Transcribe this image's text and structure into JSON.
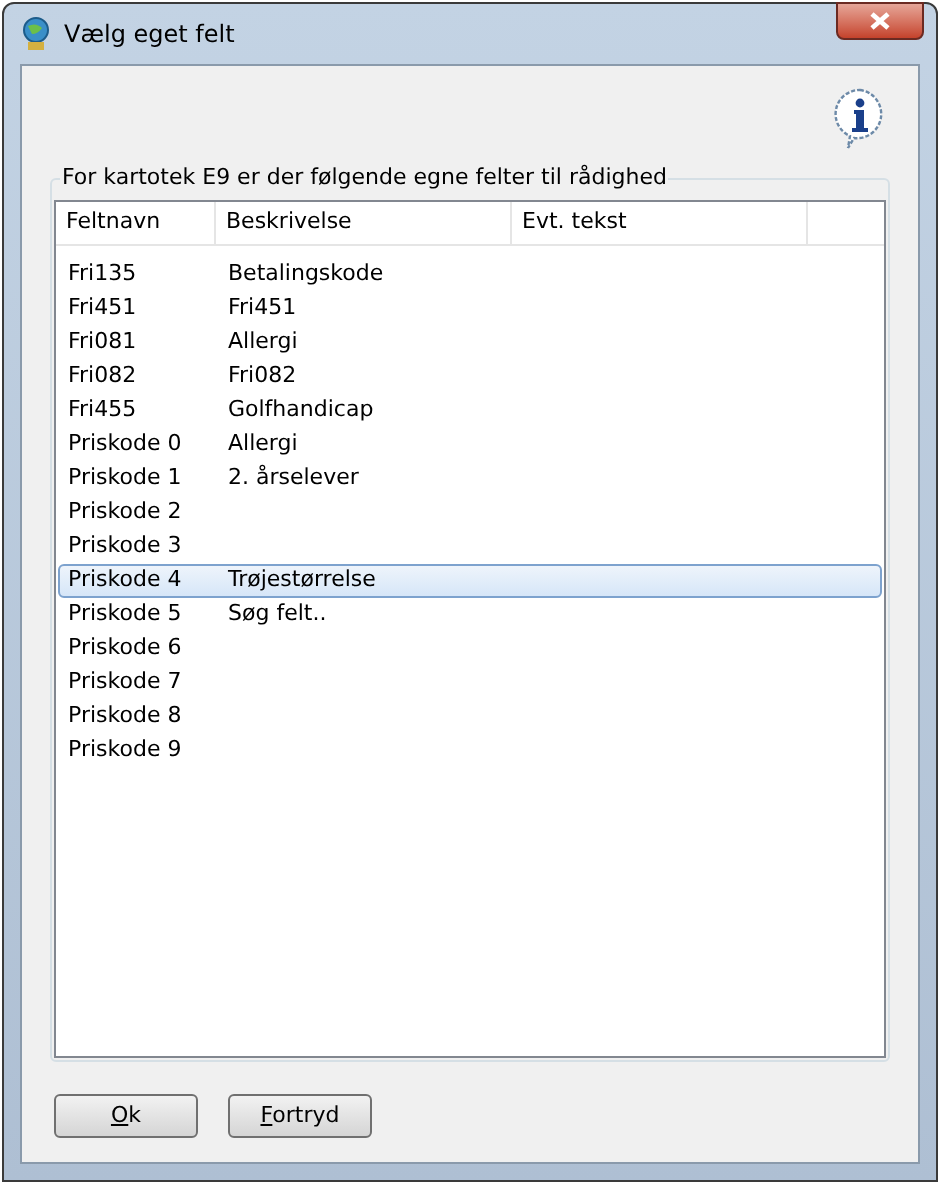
{
  "window": {
    "title": "Vælg eget felt"
  },
  "group": {
    "label": "For kartotek E9 er der følgende egne felter til rådighed"
  },
  "table": {
    "columns": [
      "Feltnavn",
      "Beskrivelse",
      "Evt. tekst"
    ],
    "rows": [
      {
        "cells": [
          "Fri135",
          "Betalingskode"
        ],
        "selected": false
      },
      {
        "cells": [
          "Fri451",
          "Fri451"
        ],
        "selected": false
      },
      {
        "cells": [
          "Fri081",
          "Allergi"
        ],
        "selected": false
      },
      {
        "cells": [
          "Fri082",
          "Fri082"
        ],
        "selected": false
      },
      {
        "cells": [
          "Fri455",
          "Golfhandicap"
        ],
        "selected": false
      },
      {
        "cells": [
          "Priskode 0",
          "Allergi"
        ],
        "selected": false
      },
      {
        "cells": [
          "Priskode 1",
          "2. årselever"
        ],
        "selected": false
      },
      {
        "cells": [
          "Priskode 2"
        ],
        "selected": false
      },
      {
        "cells": [
          "Priskode 3"
        ],
        "selected": false
      },
      {
        "cells": [
          "Priskode 4",
          "Trøjestørrelse"
        ],
        "selected": true
      },
      {
        "cells": [
          "Priskode 5",
          "Søg felt.."
        ],
        "selected": false
      },
      {
        "cells": [
          "Priskode 6"
        ],
        "selected": false
      },
      {
        "cells": [
          "Priskode 7"
        ],
        "selected": false
      },
      {
        "cells": [
          "Priskode 8"
        ],
        "selected": false
      },
      {
        "cells": [
          "Priskode 9"
        ],
        "selected": false
      }
    ]
  },
  "buttons": [
    {
      "label": "Ok",
      "first_letter_underlined": true
    },
    {
      "label": "Fortryd",
      "first_letter_underlined": true
    }
  ]
}
